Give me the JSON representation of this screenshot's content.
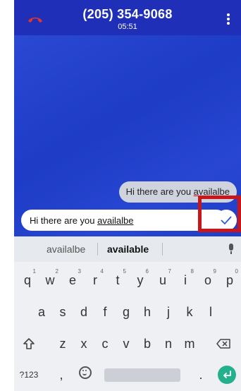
{
  "call": {
    "number": "(205) 354-9068",
    "timer": "05:51"
  },
  "chat": {
    "sent_message": "Hi there are you availalbe",
    "sent_message_plain": "Hi there are you ",
    "sent_message_typo": "availalbe",
    "input_plain": "Hi there are you ",
    "input_typo": "availalbe"
  },
  "keyboard": {
    "suggestions": [
      "availalbe",
      "available"
    ],
    "row1": [
      {
        "key": "q",
        "hint": "1"
      },
      {
        "key": "w",
        "hint": "2"
      },
      {
        "key": "e",
        "hint": "3"
      },
      {
        "key": "r",
        "hint": "4"
      },
      {
        "key": "t",
        "hint": "5"
      },
      {
        "key": "y",
        "hint": "6"
      },
      {
        "key": "u",
        "hint": "7"
      },
      {
        "key": "i",
        "hint": "8"
      },
      {
        "key": "o",
        "hint": "9"
      },
      {
        "key": "p",
        "hint": "0"
      }
    ],
    "row2": [
      "a",
      "s",
      "d",
      "f",
      "g",
      "h",
      "j",
      "k",
      "l"
    ],
    "row3": [
      "z",
      "x",
      "c",
      "v",
      "b",
      "n",
      "m"
    ],
    "symbols_label": "?123",
    "comma": ",",
    "period": "."
  },
  "colors": {
    "call_background": "#1f3fd0",
    "header_background": "#1f2fb8",
    "hangup": "#e0362f",
    "highlight_border": "#c8161b",
    "enter_key": "#24b08c",
    "send_check": "#2a5bd7"
  },
  "icons": [
    "hangup-phone-icon",
    "more-vert-icon",
    "send-check-icon",
    "mic-icon",
    "shift-icon",
    "backspace-icon",
    "emoji-icon",
    "enter-icon"
  ]
}
